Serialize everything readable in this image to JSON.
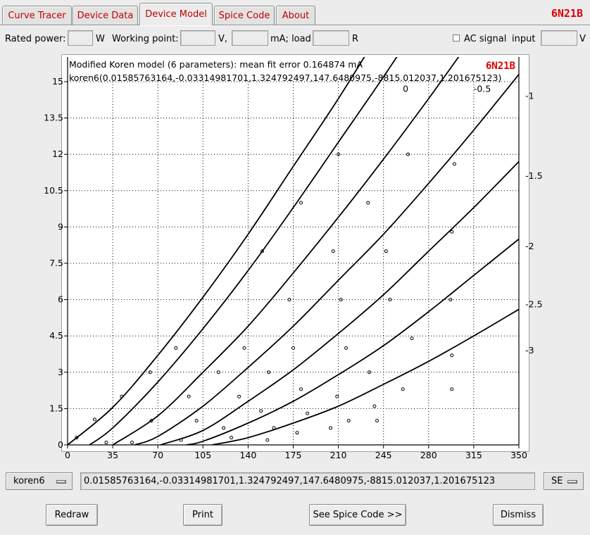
{
  "tabs": [
    {
      "label": "Curve Tracer",
      "active": false
    },
    {
      "label": "Device Data",
      "active": false
    },
    {
      "label": "Device Model",
      "active": true
    },
    {
      "label": "Spice Code",
      "active": false
    },
    {
      "label": "About",
      "active": false
    }
  ],
  "device_name": "6N21B",
  "controls": {
    "rated_power_label": "Rated power:",
    "rated_power_unit": "W",
    "working_point_label": "Working point:",
    "volt_unit": "V,",
    "ma_load_label": "mA; load",
    "ohm_unit": "R",
    "ac_signal_label": "AC signal",
    "input_label": "input",
    "input_unit": "V",
    "rated_power_value": "",
    "wp_voltage_value": "",
    "wp_current_value": "",
    "load_value": "",
    "input_value": "",
    "ac_signal_checked": false
  },
  "chart_data": {
    "type": "line",
    "title": "Modified Koren model (6 parameters): mean fit error 0.164874 mA",
    "subtitle": "koren6(0.01585763164,-0.03314981701,1.324792497,147.6480975,-8815.012037,1.201675123)",
    "device_label": "6N21B",
    "xlim": [
      0,
      350
    ],
    "ylim": [
      0,
      15
    ],
    "x_ticks": [
      0,
      35,
      70,
      105,
      140,
      175,
      210,
      245,
      280,
      315,
      350
    ],
    "y_ticks": [
      "0",
      "1.5",
      "3",
      "4.5",
      "6",
      "7.5",
      "9",
      "10.5",
      "12",
      "13.5",
      "15"
    ],
    "grid": true,
    "series": [
      {
        "name": "0",
        "x": [
          0,
          35,
          70,
          105,
          140,
          175,
          210,
          245,
          263
        ],
        "y": [
          0,
          1.55,
          3.7,
          6.1,
          8.7,
          11.5,
          14.3,
          17.3,
          18.8
        ]
      },
      {
        "name": "-0.5",
        "x": [
          17,
          35,
          70,
          105,
          140,
          175,
          210,
          245,
          280,
          305
        ],
        "y": [
          0,
          0.7,
          2.6,
          4.8,
          7.2,
          9.8,
          12.5,
          15.2,
          18,
          19.9
        ]
      },
      {
        "name": "-1",
        "x": [
          35,
          70,
          105,
          140,
          175,
          210,
          245,
          280,
          315,
          350
        ],
        "y": [
          0,
          1.2,
          3.0,
          4.9,
          7.1,
          9.4,
          11.8,
          14.3,
          16.9,
          19.5
        ]
      },
      {
        "name": "-1.5",
        "x": [
          52,
          70,
          105,
          140,
          175,
          210,
          245,
          280,
          315,
          350
        ],
        "y": [
          0,
          0.35,
          1.6,
          3.2,
          4.9,
          6.8,
          8.7,
          10.8,
          13.0,
          15.3
        ]
      },
      {
        "name": "-2",
        "x": [
          72,
          105,
          140,
          175,
          210,
          245,
          280,
          315,
          350
        ],
        "y": [
          0,
          0.6,
          1.8,
          3.1,
          4.6,
          6.2,
          8.0,
          9.8,
          11.7
        ]
      },
      {
        "name": "-2.5",
        "x": [
          92,
          105,
          140,
          175,
          210,
          245,
          280,
          315,
          350
        ],
        "y": [
          0,
          0.15,
          0.9,
          1.8,
          2.9,
          4.1,
          5.5,
          7.0,
          8.5
        ]
      },
      {
        "name": "-3",
        "x": [
          112,
          140,
          175,
          210,
          245,
          280,
          315,
          350
        ],
        "y": [
          0,
          0.3,
          0.9,
          1.6,
          2.5,
          3.45,
          4.5,
          5.6
        ]
      }
    ],
    "curve_labels": [
      {
        "text": "0",
        "x": 260,
        "y": 14.7
      },
      {
        "text": "-0.5",
        "x": 315,
        "y": 14.7
      },
      {
        "text": "-1",
        "x": 355,
        "y": 14.4
      },
      {
        "text": "-1.5",
        "x": 355,
        "y": 11.1
      },
      {
        "text": "-2",
        "x": 355,
        "y": 8.2
      },
      {
        "text": "-2.5",
        "x": 355,
        "y": 5.8
      },
      {
        "text": "-3",
        "x": 355,
        "y": 3.9
      }
    ],
    "points": [
      [
        7,
        0.3
      ],
      [
        21,
        1.05
      ],
      [
        30,
        0.1
      ],
      [
        42,
        2.0
      ],
      [
        50,
        0.1
      ],
      [
        64,
        3.0
      ],
      [
        65,
        1.0
      ],
      [
        84,
        4.0
      ],
      [
        88,
        0.2
      ],
      [
        94,
        2.0
      ],
      [
        100,
        1.0
      ],
      [
        117,
        3.0
      ],
      [
        121,
        0.7
      ],
      [
        127,
        0.3
      ],
      [
        133,
        2.0
      ],
      [
        137,
        4.0
      ],
      [
        150,
        1.4
      ],
      [
        151,
        8.0
      ],
      [
        155,
        0.2
      ],
      [
        156,
        3.0
      ],
      [
        160,
        0.7
      ],
      [
        172,
        6.0
      ],
      [
        175,
        4.0
      ],
      [
        178,
        0.5
      ],
      [
        181,
        2.3
      ],
      [
        181,
        10.0
      ],
      [
        186,
        1.3
      ],
      [
        204,
        0.7
      ],
      [
        206,
        8.0
      ],
      [
        209,
        2.0
      ],
      [
        210,
        12.0
      ],
      [
        212,
        6.0
      ],
      [
        216,
        4.0
      ],
      [
        218,
        1.0
      ],
      [
        234,
        3.0
      ],
      [
        233,
        10.0
      ],
      [
        238,
        1.6
      ],
      [
        240,
        1.0
      ],
      [
        247,
        8.0
      ],
      [
        250,
        6.0
      ],
      [
        260,
        2.3
      ],
      [
        264,
        12.0
      ],
      [
        267,
        4.4
      ],
      [
        297,
        6.0
      ],
      [
        298,
        8.8
      ],
      [
        298,
        3.7
      ],
      [
        298,
        2.3
      ],
      [
        300,
        11.6
      ]
    ]
  },
  "model_select": {
    "value": "koren6"
  },
  "params_text": "0.01585763164,-0.03314981701,1.324792497,147.6480975,-8815.012037,1.201675123",
  "mode_select": {
    "value": "SE"
  },
  "buttons": {
    "redraw": "Redraw",
    "print": "Print",
    "spice": "See Spice Code >>",
    "dismiss": "Dismiss"
  }
}
